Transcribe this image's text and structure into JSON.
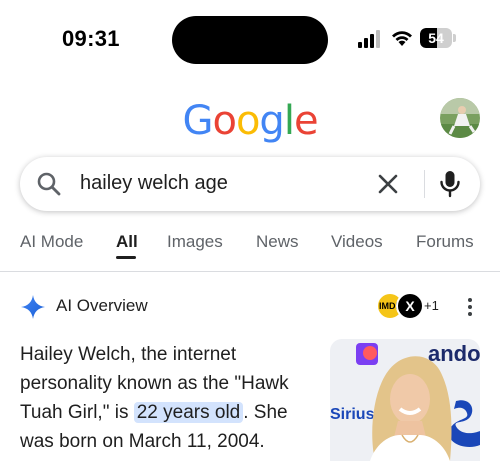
{
  "status_bar": {
    "time": "09:31",
    "battery": "54",
    "battery_level": 0.54
  },
  "header": {
    "logo": [
      "G",
      "o",
      "o",
      "g",
      "l",
      "e"
    ],
    "logo_colors": [
      "#4285F4",
      "#EA4335",
      "#FBBC05",
      "#4285F4",
      "#34A853",
      "#EA4335"
    ],
    "avatar": "avatar-image"
  },
  "search": {
    "query": "hailey welch age",
    "icon_search": "search-icon",
    "icon_clear": "close-icon",
    "icon_mic": "microphone-icon"
  },
  "tabs": [
    {
      "label": "AI Mode",
      "active": false
    },
    {
      "label": "All",
      "active": true
    },
    {
      "label": "Images",
      "active": false
    },
    {
      "label": "News",
      "active": false
    },
    {
      "label": "Videos",
      "active": false
    },
    {
      "label": "Forums",
      "active": false
    }
  ],
  "ai_overview": {
    "title": "AI Overview",
    "sources": [
      "IMDb",
      "X"
    ],
    "more_sources": "+1",
    "answer_before": "Hailey Welch, the internet personality known as the \"Hawk Tuah Girl,\" is ",
    "answer_highlight": "22 years old",
    "answer_after": ". She was born on March 11, 2004.",
    "photo_backdrop_text": [
      "andor",
      "Sirius"
    ]
  },
  "colors": {
    "accent_blue": "#1a73e8",
    "highlight": "#d3e3fd",
    "text": "#1f1f1f",
    "muted": "#5f6368"
  }
}
